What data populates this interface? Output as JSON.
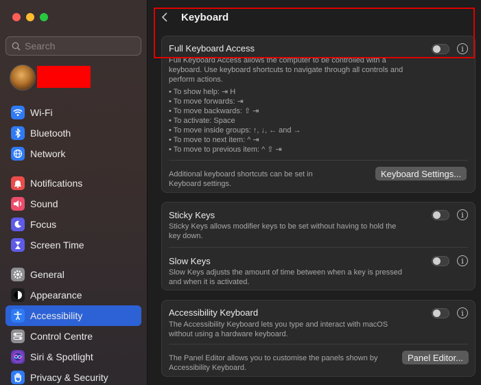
{
  "sidebar": {
    "search_placeholder": "Search",
    "groups": [
      [
        {
          "label": "Wi-Fi",
          "icon": "wifi-icon",
          "color": "#2f7bf5"
        },
        {
          "label": "Bluetooth",
          "icon": "bluetooth-icon",
          "color": "#2f7bf5"
        },
        {
          "label": "Network",
          "icon": "globe-icon",
          "color": "#2f7bf5"
        }
      ],
      [
        {
          "label": "Notifications",
          "icon": "bell-icon",
          "color": "#eb4d4b"
        },
        {
          "label": "Sound",
          "icon": "speaker-icon",
          "color": "#eb4d6b"
        },
        {
          "label": "Focus",
          "icon": "moon-icon",
          "color": "#5e5ce6"
        },
        {
          "label": "Screen Time",
          "icon": "hourglass-icon",
          "color": "#5e5ce6"
        }
      ],
      [
        {
          "label": "General",
          "icon": "gear-icon",
          "color": "#8e8e93"
        },
        {
          "label": "Appearance",
          "icon": "appearance-icon",
          "color": "#1c1c1e"
        },
        {
          "label": "Accessibility",
          "icon": "accessibility-icon",
          "color": "#2f7bf5"
        },
        {
          "label": "Control Centre",
          "icon": "control-centre-icon",
          "color": "#8e8e93"
        },
        {
          "label": "Siri & Spotlight",
          "icon": "siri-icon",
          "color": "#b04fd8"
        },
        {
          "label": "Privacy & Security",
          "icon": "hand-icon",
          "color": "#2f7bf5"
        }
      ]
    ],
    "active": "Accessibility"
  },
  "header": {
    "title": "Keyboard"
  },
  "full_keyboard_access": {
    "title": "Full Keyboard Access",
    "description": [
      "Full Keyboard Access allows the computer to be controlled with a",
      "keyboard. Use keyboard shortcuts to navigate through all controls and",
      "perform actions."
    ],
    "shortcuts": [
      "• To show help: ⇥ H",
      "• To move forwards: ⇥",
      "• To move backwards: ⇧ ⇥",
      "• To activate: Space",
      "• To move inside groups: ↑, ↓, ← and →",
      "• To move to next item: ^ ⇥",
      "• To move to previous item: ^ ⇧ ⇥"
    ],
    "footer": [
      "Additional keyboard shortcuts can be set in",
      "Keyboard settings."
    ],
    "button": "Keyboard Settings..."
  },
  "sticky_keys": {
    "title": "Sticky Keys",
    "description": [
      "Sticky Keys allows modifier keys to be set without having to hold the",
      "key down."
    ]
  },
  "slow_keys": {
    "title": "Slow Keys",
    "description": [
      "Slow Keys adjusts the amount of time between when a key is pressed",
      "and when it is activated."
    ]
  },
  "accessibility_keyboard": {
    "title": "Accessibility Keyboard",
    "description": [
      "The Accessibility Keyboard lets you type and interact with macOS",
      "without using a hardware keyboard."
    ],
    "footer": [
      "The Panel Editor allows you to customise the panels shown by",
      "Accessibility Keyboard."
    ],
    "button": "Panel Editor..."
  },
  "info_glyph": "i"
}
